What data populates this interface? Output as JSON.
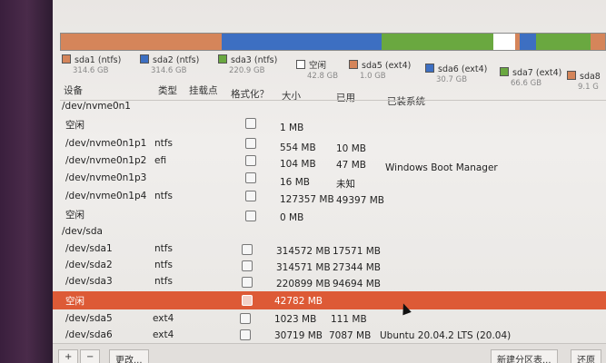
{
  "partitions": [
    {
      "label": "sda1 (ntfs)",
      "size": "314.6 GB",
      "color": "#d5855a"
    },
    {
      "label": "sda2 (ntfs)",
      "size": "314.6 GB",
      "color": "#3d6fc2"
    },
    {
      "label": "sda3 (ntfs)",
      "size": "220.9 GB",
      "color": "#6aa840"
    },
    {
      "label": "空闲",
      "size": "42.8 GB",
      "color": "#ffffff"
    },
    {
      "label": "sda5 (ext4)",
      "size": "1.0 GB",
      "color": "#d5855a"
    },
    {
      "label": "sda6 (ext4)",
      "size": "30.7 GB",
      "color": "#3d6fc2"
    },
    {
      "label": "sda7 (ext4)",
      "size": "66.6 GB",
      "color": "#6aa840"
    },
    {
      "label": "sda8",
      "size": "9.1 G",
      "color": "#d5855a"
    }
  ],
  "headers": {
    "device": "设备",
    "type": "类型",
    "mount": "挂载点",
    "format": "格式化？",
    "size": "大小",
    "used": "已用",
    "system": "已装系统"
  },
  "rows": [
    {
      "device": "/dev/nvme0n1",
      "type": "",
      "size": "",
      "used": "",
      "system": "",
      "group": true
    },
    {
      "device": "空闲",
      "type": "",
      "size": "1 MB",
      "used": "",
      "system": "",
      "check": true
    },
    {
      "device": "/dev/nvme0n1p1",
      "type": "ntfs",
      "size": "554 MB",
      "used": "10 MB",
      "system": "",
      "check": true
    },
    {
      "device": "/dev/nvme0n1p2",
      "type": "efi",
      "size": "104 MB",
      "used": "47 MB",
      "system": "Windows Boot Manager",
      "check": true
    },
    {
      "device": "/dev/nvme0n1p3",
      "type": "",
      "size": "16 MB",
      "used": "未知",
      "system": "",
      "check": true
    },
    {
      "device": "/dev/nvme0n1p4",
      "type": "ntfs",
      "size": "127357 MB",
      "used": "49397 MB",
      "system": "",
      "check": true
    },
    {
      "device": "空闲",
      "type": "",
      "size": "0 MB",
      "used": "",
      "system": "",
      "check": true
    },
    {
      "device": "/dev/sda",
      "type": "",
      "size": "",
      "used": "",
      "system": "",
      "group": true
    },
    {
      "device": "/dev/sda1",
      "type": "ntfs",
      "size": "314572 MB",
      "used": "17571 MB",
      "system": "",
      "check": true
    },
    {
      "device": "/dev/sda2",
      "type": "ntfs",
      "size": "314571 MB",
      "used": "27344 MB",
      "system": "",
      "check": true
    },
    {
      "device": "/dev/sda3",
      "type": "ntfs",
      "size": "220899 MB",
      "used": "94694 MB",
      "system": "",
      "check": true
    },
    {
      "device": "空闲",
      "type": "",
      "size": "42782 MB",
      "used": "",
      "system": "",
      "check": true,
      "selected": true
    },
    {
      "device": "/dev/sda5",
      "type": "ext4",
      "size": "1023 MB",
      "used": "111 MB",
      "system": "",
      "check": true
    },
    {
      "device": "/dev/sda6",
      "type": "ext4",
      "size": "30719 MB",
      "used": "7087 MB",
      "system": "Ubuntu 20.04.2 LTS (20.04)",
      "check": true
    }
  ],
  "buttons": {
    "add": "+",
    "remove": "−",
    "change": "更改...",
    "new_table": "新建分区表...",
    "restore": "还原"
  }
}
